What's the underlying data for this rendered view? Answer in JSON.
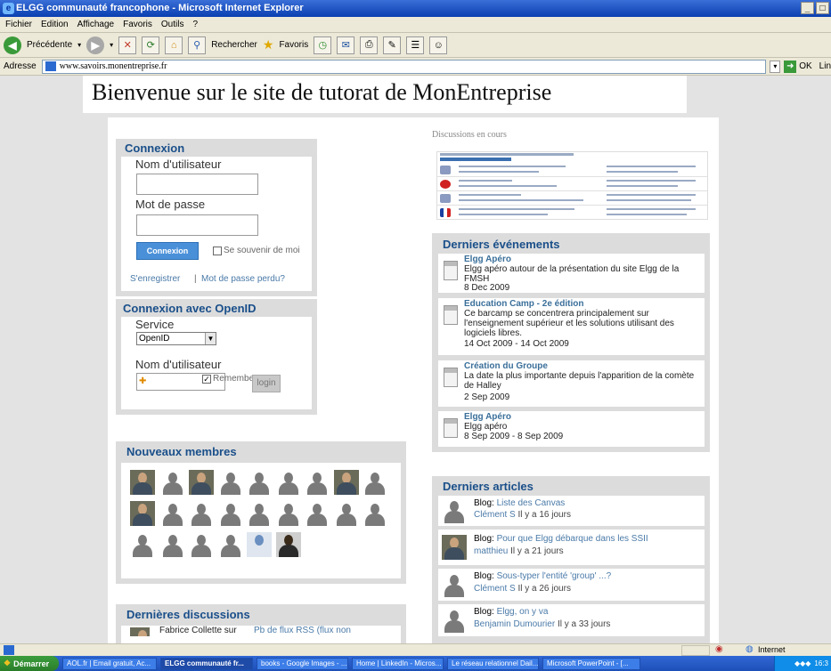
{
  "window": {
    "title": "ELGG communauté francophone - Microsoft Internet Explorer",
    "controls": [
      "_",
      "□",
      "×"
    ]
  },
  "menu": [
    "Fichier",
    "Edition",
    "Affichage",
    "Favoris",
    "Outils",
    "?"
  ],
  "toolbar": {
    "back_label": "Précédente",
    "search_label": "Rechercher",
    "favorites_label": "Favoris"
  },
  "address": {
    "label": "Adresse",
    "url": "www.savoirs.monentreprise.fr",
    "go_label": "OK",
    "links_label": "Lin"
  },
  "site": {
    "title": "Bienvenue sur le site de tutorat de MonEntreprise"
  },
  "login": {
    "title": "Connexion",
    "username_label": "Nom d'utilisateur",
    "password_label": "Mot de passe",
    "submit_label": "Connexion",
    "remember_label": "Se souvenir de moi",
    "register_link": "S'enregistrer",
    "separator": "|",
    "forgot_link": "Mot de passe perdu?"
  },
  "openid": {
    "title": "Connexion avec OpenID",
    "service_label": "Service",
    "service_value": "OpenID",
    "username_label": "Nom d'utilisateur",
    "remember_label": "Remember",
    "login_label": "login"
  },
  "members": {
    "title": "Nouveaux membres"
  },
  "discussions_right": {
    "title": "Discussions en cours"
  },
  "discussions_left": {
    "title": "Dernières discussions",
    "first_item": "Fabrice Collette sur",
    "first_item_link": "Pb de flux RSS (flux non"
  },
  "events": {
    "title": "Derniers événements",
    "items": [
      {
        "title": "Elgg Apéro",
        "desc": "Elgg apéro autour de la présentation du site Elgg de la FMSH",
        "date": "8 Dec 2009"
      },
      {
        "title": "Education Camp - 2e édition",
        "desc": "Ce barcamp se concentrera principalement sur l'enseignement supérieur et les solutions utilisant des logiciels libres.",
        "date": "14 Oct 2009 - 14 Oct 2009"
      },
      {
        "title": "Création du Groupe",
        "desc": "La date la plus importante depuis l'apparition de la comète de Halley",
        "date": "2 Sep 2009"
      },
      {
        "title": "Elgg Apéro",
        "desc": "Elgg apéro",
        "date": "8 Sep 2009 - 8 Sep 2009"
      }
    ]
  },
  "articles": {
    "title": "Derniers articles",
    "items": [
      {
        "prefix": "Blog:",
        "title": "Liste des Canvas",
        "author": "Clément S",
        "ago": "Il y a 16 jours"
      },
      {
        "prefix": "Blog:",
        "title": "Pour que Elgg débarque dans les SSII",
        "author": "matthieu",
        "ago": "Il y a 21 jours"
      },
      {
        "prefix": "Blog:",
        "title": "Sous-typer l'entité 'group' ...?",
        "author": "Clément S",
        "ago": "Il y a 26 jours"
      },
      {
        "prefix": "Blog:",
        "title": "Elgg, on y va",
        "author": "Benjamin Dumourier",
        "ago": "Il y a 33 jours"
      }
    ]
  },
  "status": {
    "zone": "Internet"
  },
  "taskbar": {
    "start": "Démarrer",
    "tasks": [
      "AOL.fr | Email gratuit, Ac...",
      "ELGG communauté fr...",
      "books - Google Images - ...",
      "Home | LinkedIn - Micros...",
      "Le réseau relationnel Dail...",
      "Microsoft PowerPoint - [..."
    ],
    "clock": "16:3"
  },
  "colors": {
    "accent": "#1a4f8a",
    "link": "#4a7aa8",
    "button": "#4a90d9"
  }
}
